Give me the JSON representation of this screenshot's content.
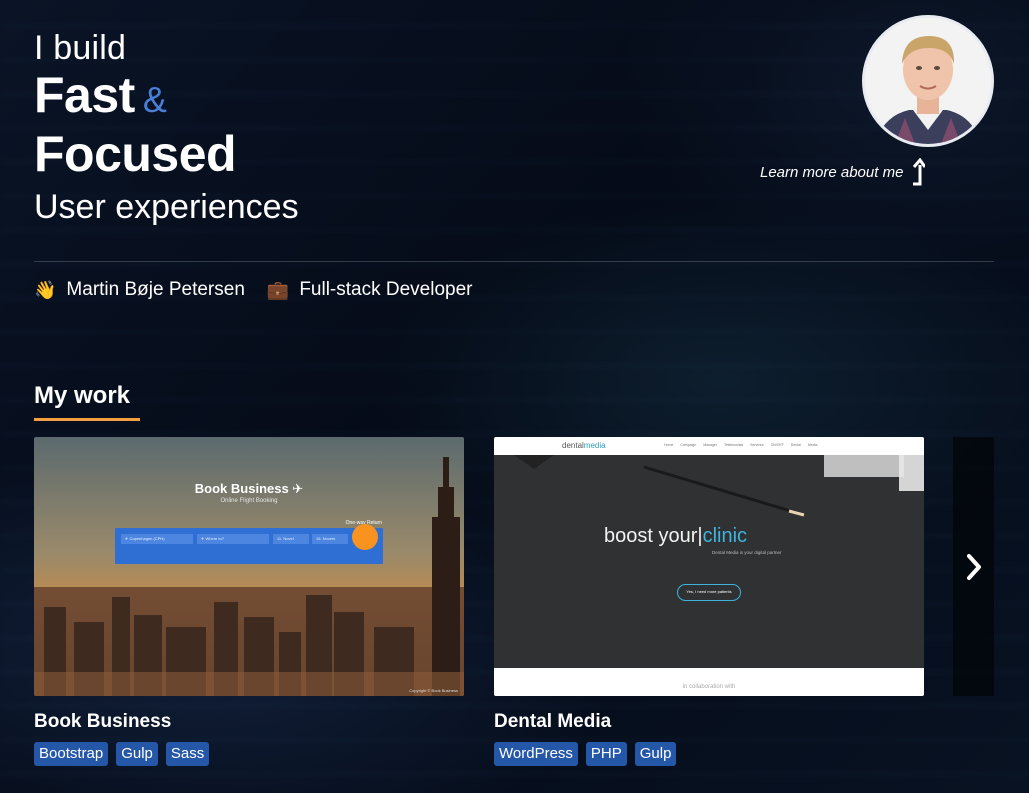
{
  "hero": {
    "intro": "I build",
    "line1": "Fast",
    "amp": "&",
    "line2": "Focused",
    "tail": "User experiences"
  },
  "profile": {
    "learn_more": "Learn more about me"
  },
  "meta": {
    "name_icon": "👋",
    "name": "Martin Bøje Petersen",
    "role_icon": "💼",
    "role": "Full-stack Developer"
  },
  "work": {
    "title": "My work",
    "projects": [
      {
        "title": "Book Business",
        "tags": [
          "Bootstrap",
          "Gulp",
          "Sass"
        ],
        "preview": {
          "heading": "Book Business ✈",
          "subheading": "Online Flight Booking",
          "trip_options": "One-way   Return",
          "from": "✈ Copenhagen (CPH)",
          "to": "✈ Where to?",
          "date_out": "11. Novel",
          "date_back": "15. Novem",
          "copyright": "Copyright © Book Business"
        }
      },
      {
        "title": "Dental Media",
        "tags": [
          "WordPress",
          "PHP",
          "Gulp"
        ],
        "preview": {
          "logo_a": "dental",
          "logo_b": "media",
          "nav": "Home  Campaign Manager  Testimonials  Services  ON/OFF  Dental Media",
          "headline_a": "boost your",
          "headline_b": "clinic",
          "tagline": "Dental Media is your digital partner",
          "cta": "Yes, I need more patients",
          "footer": "in collaboration with"
        }
      }
    ]
  },
  "colors": {
    "accent_underline": "#f5a040",
    "tag_bg": "#2557a8",
    "amp": "#4a7fd8"
  }
}
